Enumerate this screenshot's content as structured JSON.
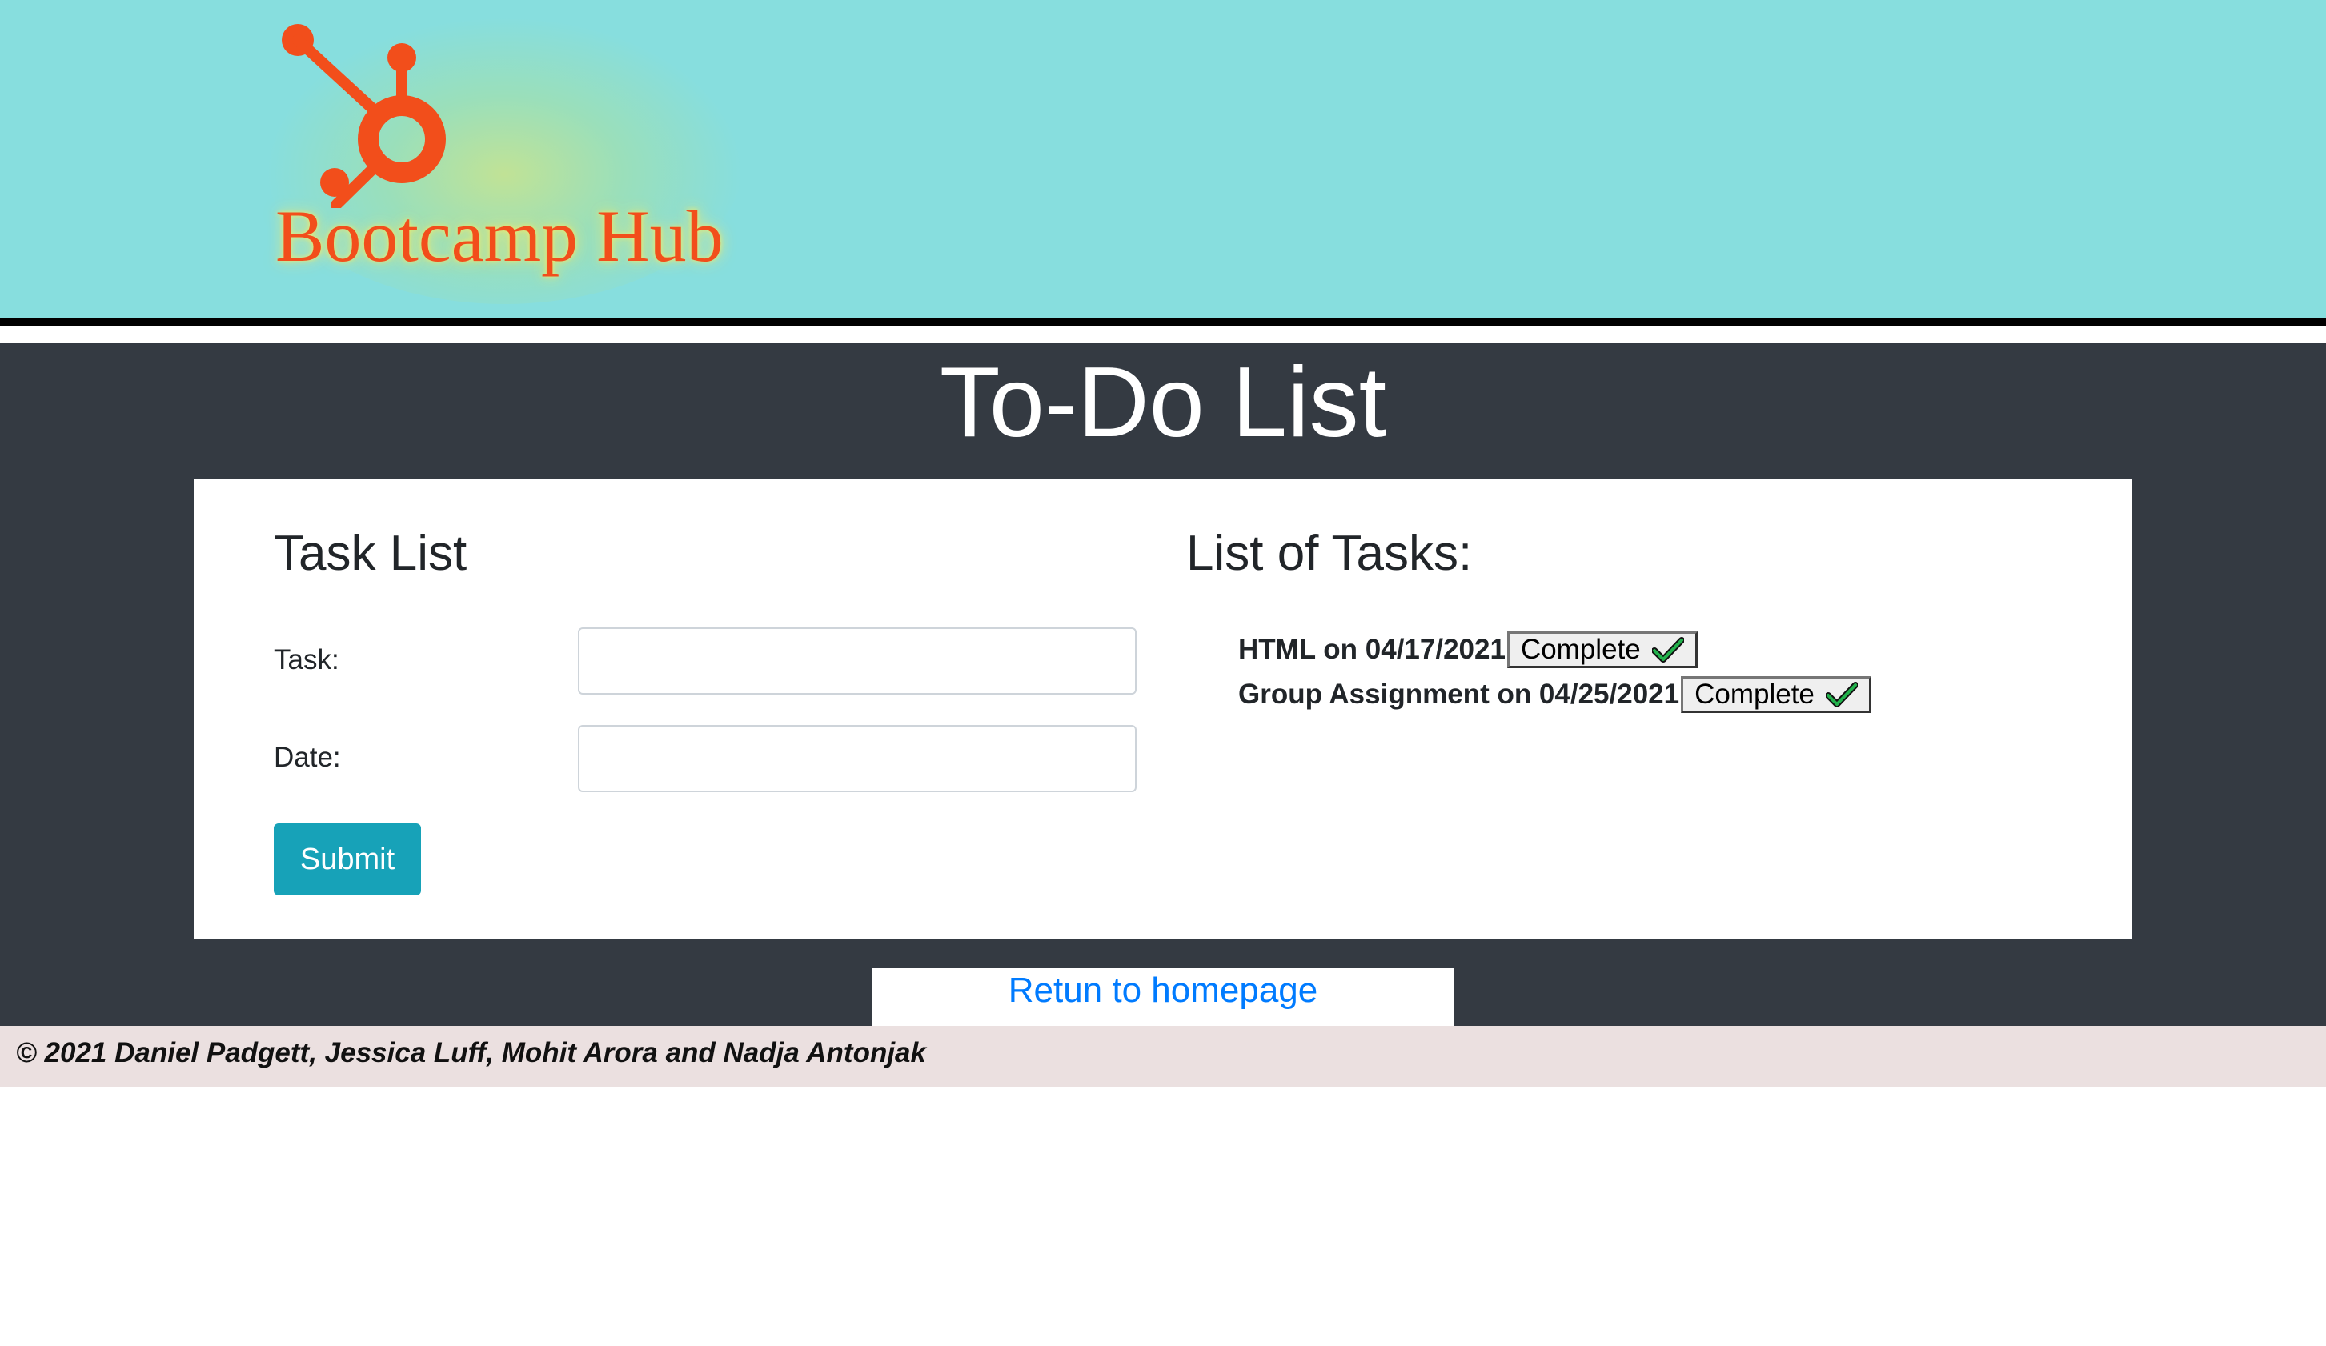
{
  "header": {
    "logo_text": "Bootcamp Hub",
    "brand_color": "#f24e1b",
    "background_color": "#87dede",
    "logo_icon": "hubspot-sprocket-icon"
  },
  "main": {
    "title": "To-Do List",
    "background_color": "#343a42"
  },
  "form": {
    "heading": "Task List",
    "task_label": "Task:",
    "task_value": "",
    "date_label": "Date:",
    "date_value": "",
    "submit_label": "Submit",
    "submit_color": "#17a2b8"
  },
  "tasks": {
    "heading": "List of Tasks:",
    "items": [
      {
        "text": "HTML on 04/17/2021",
        "button_label": "Complete",
        "button_icon": "checkmark-icon"
      },
      {
        "text": "Group Assignment on 04/25/2021",
        "button_label": "Complete",
        "button_icon": "checkmark-icon"
      }
    ]
  },
  "links": {
    "return_home": "Retun to homepage"
  },
  "footer": {
    "text": "© 2021 Daniel Padgett, Jessica Luff, Mohit Arora and Nadja Antonjak"
  }
}
